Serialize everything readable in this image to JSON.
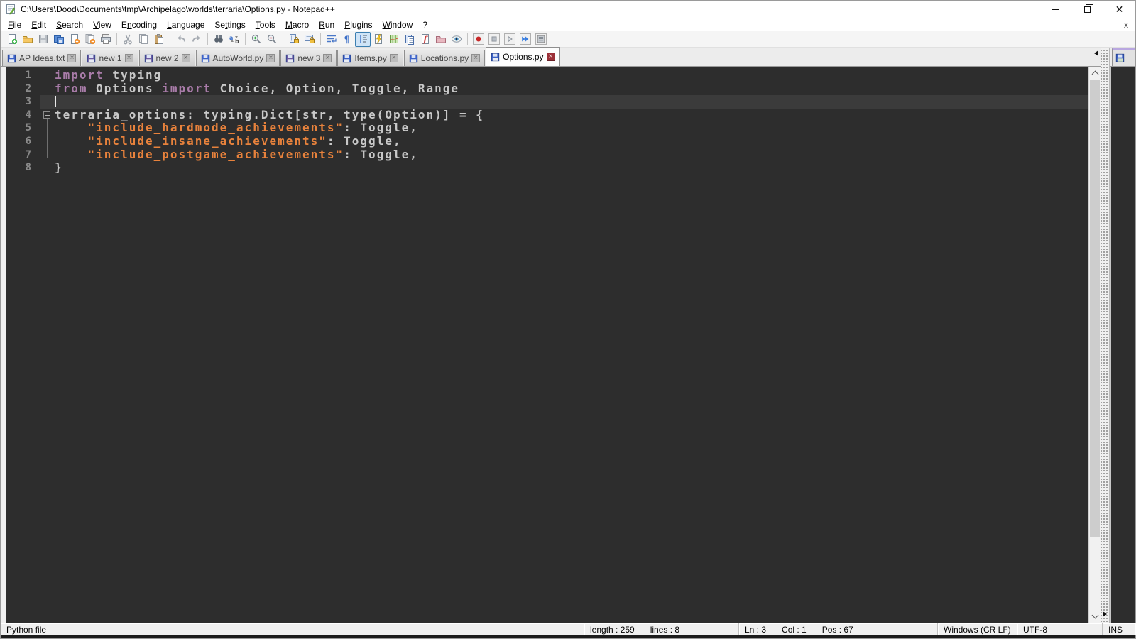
{
  "title_bar": {
    "title": "C:\\Users\\Dood\\Documents\\tmp\\Archipelago\\worlds\\terraria\\Options.py - Notepad++",
    "minimize": "minimize",
    "restore": "restore",
    "close": "✕"
  },
  "menu_bar": {
    "items": [
      {
        "label": "File",
        "u": 0
      },
      {
        "label": "Edit",
        "u": 0
      },
      {
        "label": "Search",
        "u": 0
      },
      {
        "label": "View",
        "u": 0
      },
      {
        "label": "Encoding",
        "u": 1
      },
      {
        "label": "Language",
        "u": 0
      },
      {
        "label": "Settings",
        "u": 2
      },
      {
        "label": "Tools",
        "u": 0
      },
      {
        "label": "Macro",
        "u": 0
      },
      {
        "label": "Run",
        "u": 0
      },
      {
        "label": "Plugins",
        "u": 0
      },
      {
        "label": "Window",
        "u": 0
      },
      {
        "label": "?",
        "u": -1
      }
    ],
    "close_doc_label": "x"
  },
  "toolbar": {
    "buttons": [
      {
        "icon": "new-file"
      },
      {
        "icon": "open-folder"
      },
      {
        "icon": "save"
      },
      {
        "icon": "save-all"
      },
      {
        "icon": "close"
      },
      {
        "icon": "close-all"
      },
      {
        "icon": "print"
      },
      {
        "icon": "sep"
      },
      {
        "icon": "cut"
      },
      {
        "icon": "copy"
      },
      {
        "icon": "paste"
      },
      {
        "icon": "sep"
      },
      {
        "icon": "undo"
      },
      {
        "icon": "redo"
      },
      {
        "icon": "sep"
      },
      {
        "icon": "find"
      },
      {
        "icon": "replace"
      },
      {
        "icon": "sep"
      },
      {
        "icon": "zoom-in"
      },
      {
        "icon": "zoom-out"
      },
      {
        "icon": "sep"
      },
      {
        "icon": "sync-vertical"
      },
      {
        "icon": "sync-horizontal"
      },
      {
        "icon": "sep"
      },
      {
        "icon": "word-wrap"
      },
      {
        "icon": "show-all-chars"
      },
      {
        "icon": "indent-guide",
        "active": true
      },
      {
        "icon": "user-defined-language"
      },
      {
        "icon": "document-map"
      },
      {
        "icon": "document-list"
      },
      {
        "icon": "function-list"
      },
      {
        "icon": "folder-as-workspace"
      },
      {
        "icon": "monitoring"
      },
      {
        "icon": "sep"
      },
      {
        "icon": "macro-record",
        "boxed": true
      },
      {
        "icon": "macro-stop",
        "boxed": true
      },
      {
        "icon": "macro-play",
        "boxed": true
      },
      {
        "icon": "macro-run-multiple",
        "boxed": true
      },
      {
        "icon": "macro-save",
        "boxed": true
      }
    ]
  },
  "tab_bar": {
    "tabs": [
      {
        "label": "AP Ideas.txt",
        "modified": false,
        "active": false
      },
      {
        "label": "new 1",
        "modified": true,
        "active": false
      },
      {
        "label": "new 2",
        "modified": true,
        "active": false
      },
      {
        "label": "AutoWorld.py",
        "modified": false,
        "active": false
      },
      {
        "label": "new 3",
        "modified": true,
        "active": false
      },
      {
        "label": "Items.py",
        "modified": false,
        "active": false
      },
      {
        "label": "Locations.py",
        "modified": false,
        "active": false
      },
      {
        "label": "Options.py",
        "modified": false,
        "active": true
      }
    ],
    "close_glyph": "×"
  },
  "editor": {
    "lines": [
      {
        "num": "1",
        "fold": "",
        "tokens": [
          {
            "t": "import",
            "c": "kw"
          },
          {
            "t": " typing",
            "c": "def"
          }
        ]
      },
      {
        "num": "2",
        "fold": "",
        "tokens": [
          {
            "t": "from",
            "c": "kw"
          },
          {
            "t": " Options ",
            "c": "def"
          },
          {
            "t": "import",
            "c": "kw"
          },
          {
            "t": " Choice, Option, Toggle, Range",
            "c": "def"
          }
        ]
      },
      {
        "num": "3",
        "fold": "",
        "current": true,
        "caret": true,
        "tokens": []
      },
      {
        "num": "4",
        "fold": "box",
        "tokens": [
          {
            "t": "terraria_options: typing.Dict[str, type(Option)] = {",
            "c": "def"
          }
        ]
      },
      {
        "num": "5",
        "fold": "line",
        "tokens": [
          {
            "t": "    ",
            "c": "def"
          },
          {
            "t": "\"include_hardmode_achievements\"",
            "c": "str"
          },
          {
            "t": ": Toggle,",
            "c": "def"
          }
        ]
      },
      {
        "num": "6",
        "fold": "line",
        "tokens": [
          {
            "t": "    ",
            "c": "def"
          },
          {
            "t": "\"include_insane_achievements\"",
            "c": "str"
          },
          {
            "t": ": Toggle,",
            "c": "def"
          }
        ]
      },
      {
        "num": "7",
        "fold": "end",
        "tokens": [
          {
            "t": "    ",
            "c": "def"
          },
          {
            "t": "\"include_postgame_achievements\"",
            "c": "str"
          },
          {
            "t": ": Toggle,",
            "c": "def"
          }
        ]
      },
      {
        "num": "8",
        "fold": "",
        "tokens": [
          {
            "t": "}",
            "c": "def"
          }
        ]
      }
    ]
  },
  "status_bar": {
    "doc_type": "Python file",
    "length_label": "length : 259",
    "lines_label": "lines : 8",
    "ln_label": "Ln : 3",
    "col_label": "Col : 1",
    "pos_label": "Pos : 67",
    "eol": "Windows (CR LF)",
    "encoding": "UTF-8",
    "insert_mode": "INS"
  },
  "colors": {
    "editor_bg": "#2d2d2d",
    "current_line_bg": "#3b3b3b",
    "keyword": "#a97ca9",
    "string": "#e8823c",
    "default_text": "#c8c8c8",
    "line_number": "#8a8a8a",
    "active_tab_close_bg": "#9c3038",
    "saved_floppy": "#3c62c8",
    "modified_floppy": "#6e5aa0"
  }
}
